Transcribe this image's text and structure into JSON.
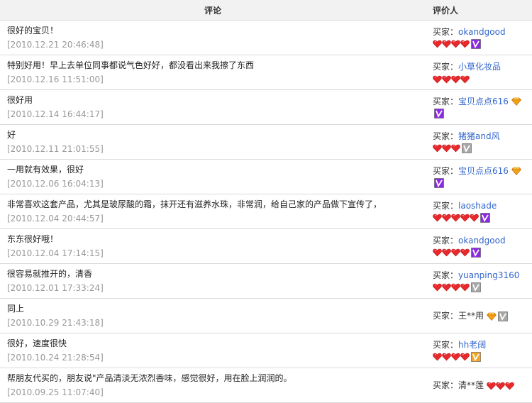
{
  "header": {
    "comment": "评论",
    "reviewer": "评价人"
  },
  "buyer_prefix": "买家：",
  "colors": {
    "link": "#3366cc",
    "date": "#999999",
    "heart": "#e8292c",
    "diamond": "#f4a21a",
    "badge_purple": "#8a2be2",
    "badge_gray": "#a8a8a8",
    "badge_orange": "#f2a526"
  },
  "reviews": [
    {
      "comment": "很好的宝贝！",
      "date": "[2010.12.21 20:46:48]",
      "name": "okandgood",
      "link": true,
      "hearts": 4,
      "diamond": false,
      "badge": "purple-v-icon",
      "inline": false
    },
    {
      "comment": "特别好用！早上去单位同事都说气色好好，都没看出来我擦了东西",
      "date": "[2010.12.16 11:51:00]",
      "name": "小草化妆品",
      "link": true,
      "hearts": 4,
      "diamond": false,
      "badge": "",
      "inline": false
    },
    {
      "comment": "很好用",
      "date": "[2010.12.14 16:44:17]",
      "name": "宝贝点点616",
      "link": true,
      "hearts": 0,
      "diamond": true,
      "badge": "purple-v-icon",
      "inline": false
    },
    {
      "comment": "好",
      "date": "[2010.12.11 21:01:55]",
      "name": "猪猪and风",
      "link": true,
      "hearts": 3,
      "diamond": false,
      "badge": "gray-v-icon",
      "inline": false
    },
    {
      "comment": "一用就有效果，很好",
      "date": "[2010.12.06 16:04:13]",
      "name": "宝贝点点616",
      "link": true,
      "hearts": 0,
      "diamond": true,
      "badge": "purple-v-icon",
      "inline": false
    },
    {
      "comment": "非常喜欢这套产品，尤其是玻尿酸的霜，抹开还有滋养水珠，非常润，给自己家的产品做下宣传了，",
      "date": "[2010.12.04 20:44:57]",
      "name": "laoshade",
      "link": true,
      "hearts": 5,
      "diamond": false,
      "badge": "purple-v-icon",
      "inline": false
    },
    {
      "comment": "东东很好哦！",
      "date": "[2010.12.04 17:14:15]",
      "name": "okandgood",
      "link": true,
      "hearts": 4,
      "diamond": false,
      "badge": "purple-v-icon",
      "inline": false
    },
    {
      "comment": "很容易就推开的，清香",
      "date": "[2010.12.01 17:33:24]",
      "name": "yuanping3160",
      "link": true,
      "hearts": 4,
      "diamond": false,
      "badge": "gray-v-icon",
      "inline": false
    },
    {
      "comment": "同上",
      "date": "[2010.10.29 21:43:18]",
      "name": "王**用",
      "link": false,
      "hearts": 0,
      "diamond": true,
      "badge": "gray-v-icon",
      "inline": true
    },
    {
      "comment": "很好，速度很快",
      "date": "[2010.10.24 21:28:54]",
      "name": "hh老阔",
      "link": true,
      "hearts": 4,
      "diamond": false,
      "badge": "orange-v-icon",
      "inline": false
    },
    {
      "comment": "帮朋友代买的，朋友说\"产品清淡无浓烈香味，感觉很好，用在脸上润润的。",
      "date": "[2010.09.25 11:07:40]",
      "name": "清**莲",
      "link": false,
      "hearts": 3,
      "diamond": false,
      "badge": "",
      "inline": true
    }
  ]
}
